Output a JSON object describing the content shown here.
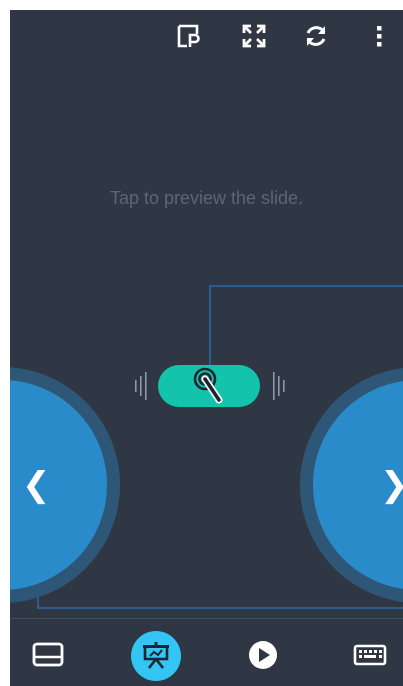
{
  "app": {
    "preview_hint": "Tap to preview the slide.",
    "colors": {
      "background": "#2e3743",
      "pointer_accent": "#14c3ab",
      "nav_button": "#2a8bca",
      "active_tab": "#33c5f3"
    }
  },
  "top_bar": {
    "icons": [
      "presentation-file-icon",
      "fullscreen-icon",
      "refresh-icon",
      "more-vert-icon"
    ]
  },
  "pointer": {
    "icon": "laser-pointer-icon"
  },
  "navigation": {
    "prev_symbol": "❮",
    "next_symbol": "❯"
  },
  "bottom_bar": {
    "items": [
      "touchpad-icon",
      "presenter-icon",
      "play-icon",
      "keyboard-icon"
    ],
    "active_index": 1
  }
}
